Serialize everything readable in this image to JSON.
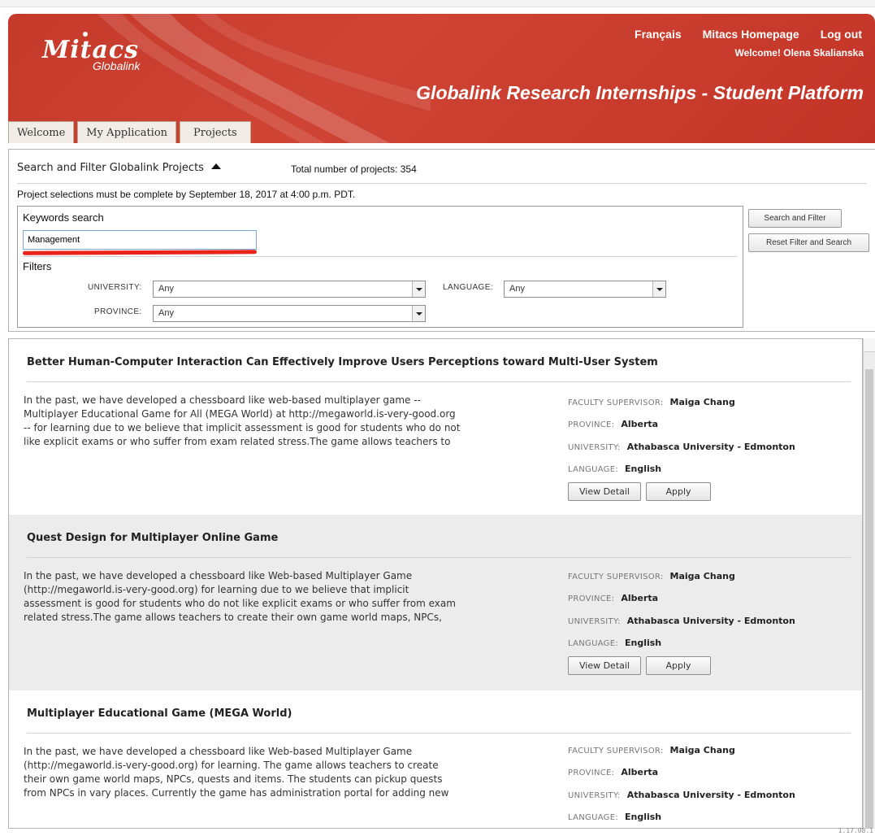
{
  "header": {
    "logo_main": "Mitacs",
    "logo_sub": "Globalink",
    "links": [
      "Français",
      "Mitacs Homepage",
      "Log out"
    ],
    "welcome": "Welcome! Olena Skalianska",
    "platform_title": "Globalink Research Internships - Student Platform",
    "tabs": [
      "Welcome",
      "My Application",
      "Projects"
    ],
    "active_tab": "Projects"
  },
  "search": {
    "title": "Search and Filter Globalink Projects",
    "total": "Total number of projects: 354",
    "deadline": "Project selections must be complete by September 18, 2017 at 4:00 p.m. PDT.",
    "keywords_label": "Keywords search",
    "keywords_value": "Management",
    "filters_label": "Filters",
    "university_label": "UNIVERSITY:",
    "university_value": "Any",
    "language_label": "LANGUAGE:",
    "language_value": "Any",
    "province_label": "PROVINCE:",
    "province_value": "Any",
    "search_button": "Search and Filter",
    "reset_button": "Reset Filter and Search"
  },
  "labels": {
    "supervisor": "FACULTY SUPERVISOR:",
    "province": "PROVINCE:",
    "university": "UNIVERSITY:",
    "language": "LANGUAGE:",
    "view_detail": "View Detail",
    "apply": "Apply"
  },
  "projects": [
    {
      "title": "Better Human-Computer Interaction Can Effectively Improve Users Perceptions toward Multi-User System",
      "lines": [
        "In the past, we have developed a chessboard like web-based multiplayer game --",
        "Multiplayer Educational Game for All (MEGA World) at http://megaworld.is-very-good.org",
        "-- for learning due to we believe that implicit assessment is good for students who do not",
        "like explicit exams or who suffer from exam related stress.The game allows teachers to"
      ],
      "supervisor": "Maiga Chang",
      "province": "Alberta",
      "university": "Athabasca University - Edmonton",
      "language": "English"
    },
    {
      "title": "Quest Design for Multiplayer Online Game",
      "lines": [
        "In the past, we have developed a chessboard like Web-based Multiplayer Game",
        "(http://megaworld.is-very-good.org) for learning due to we believe that implicit",
        "assessment is good for students who do not like explicit exams or who suffer from exam",
        "related stress.The game allows teachers to create their own game world maps, NPCs,"
      ],
      "supervisor": "Maiga Chang",
      "province": "Alberta",
      "university": "Athabasca University - Edmonton",
      "language": "English"
    },
    {
      "title": "Multiplayer Educational Game (MEGA World)",
      "lines": [
        "In the past, we have developed a chessboard like Web-based Multiplayer Game",
        "(http://megaworld.is-very-good.org) for learning. The game allows teachers to create",
        "their own game world maps, NPCs, quests and items. The students can pickup quests",
        "from NPCs in vary places. Currently the game has administration portal for adding new"
      ],
      "supervisor": "Maiga Chang",
      "province": "Alberta",
      "university": "Athabasca University - Edmonton",
      "language": "English"
    }
  ],
  "version": "1.17.08.1"
}
